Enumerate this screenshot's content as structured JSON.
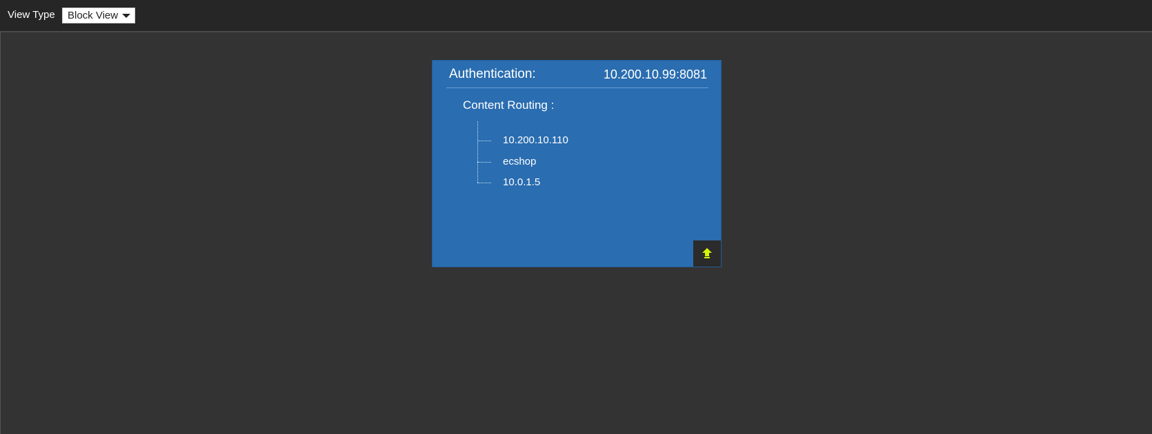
{
  "toolbar": {
    "view_type_label": "View Type",
    "view_select": {
      "selected": "Block View"
    }
  },
  "block": {
    "title": "Authentication:",
    "address": "10.200.10.99:8081",
    "section_label": "Content Routing :",
    "routes": [
      {
        "label": "10.200.10.110"
      },
      {
        "label": "ecshop"
      },
      {
        "label": "10.0.1.5"
      }
    ],
    "expand_icon": "arrow-up-icon"
  },
  "colors": {
    "toolbar_bg": "#262626",
    "canvas_bg": "#333333",
    "block_bg": "#2a6db0",
    "icon_accent": "#d4f50a"
  }
}
